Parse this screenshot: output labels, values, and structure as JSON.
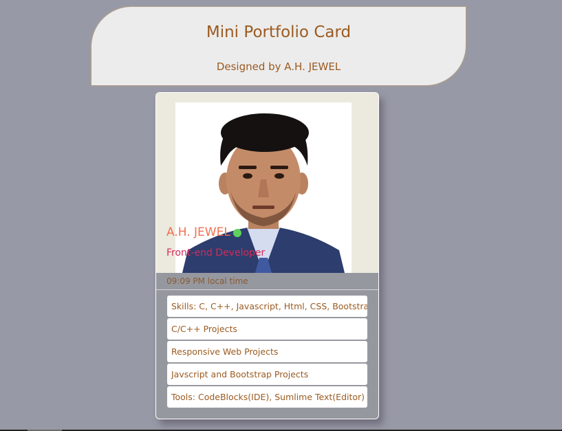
{
  "header": {
    "title": "Mini Portfolio Card",
    "subtitle": "Designed by A.H. JEWEL"
  },
  "card": {
    "name": "A.H. JEWEL",
    "role": "Front-end Developer",
    "local_time": "09:09 PM local time",
    "status": "online",
    "items": [
      "Skills: C, C++, Javascript, Html, CSS, Bootstrap",
      "C/C++ Projects",
      "Responsive Web Projects",
      "Javscript and Bootstrap Projects",
      "Tools: CodeBlocks(IDE), Sumlime Text(Editor)"
    ]
  },
  "colors": {
    "background": "#9799a6",
    "accent_text": "#9b5a20",
    "name": "#f07050",
    "role": "#d22c5a",
    "status_dot": "#5ed05c"
  }
}
